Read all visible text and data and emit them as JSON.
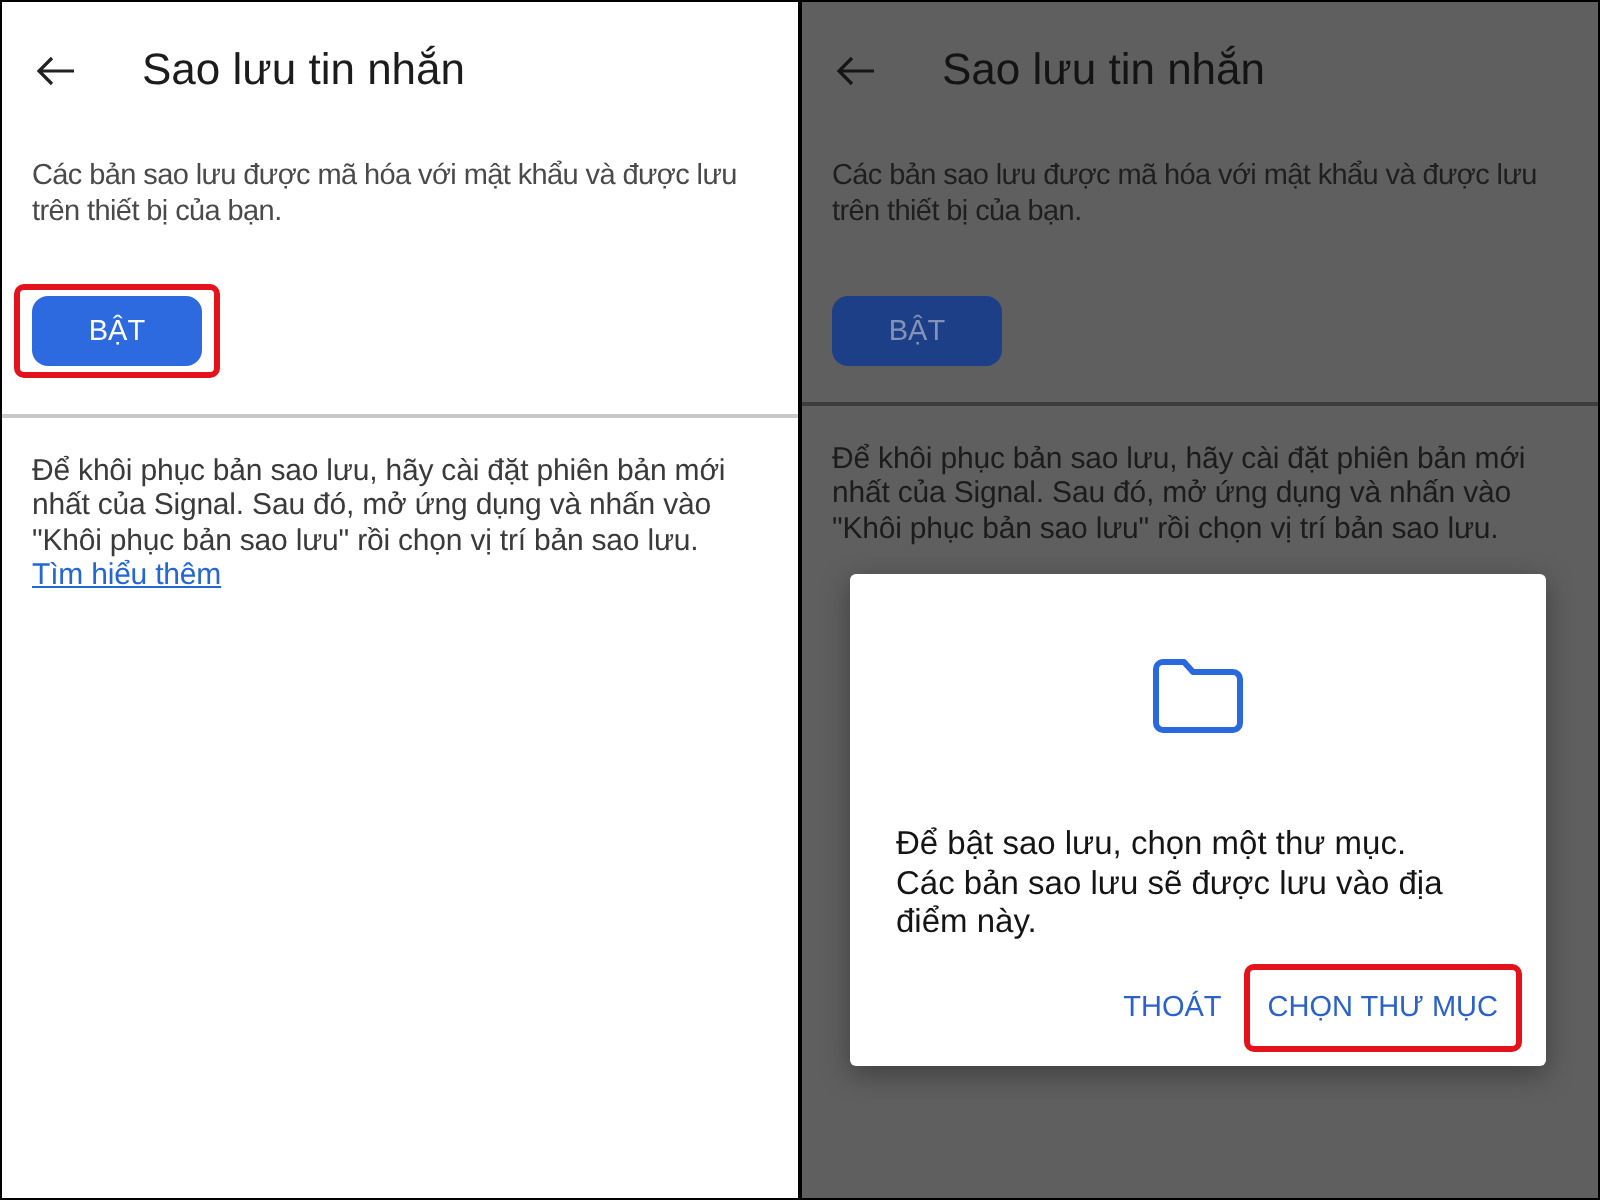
{
  "screens": [
    {
      "dimmed": false,
      "header": {
        "title": "Sao lưu tin nhắn"
      },
      "description": "Các bản sao lưu được mã hóa với mật khẩu và được lưu trên thiết bị của bạn.",
      "enable_button": {
        "label": "BẬT",
        "highlighted": true
      },
      "restore_text": "Để khôi phục bản sao lưu, hãy cài đặt phiên bản mới nhất của Signal. Sau đó, mở ứng dụng và nhấn vào \"Khôi phục bản sao lưu\" rồi chọn vị trí bản sao lưu.",
      "learn_more_link": "Tìm hiểu thêm"
    },
    {
      "dimmed": true,
      "header": {
        "title": "Sao lưu tin nhắn"
      },
      "description": "Các bản sao lưu được mã hóa với mật khẩu và được lưu trên thiết bị của bạn.",
      "enable_button": {
        "label": "BẬT",
        "highlighted": false
      },
      "restore_text": "Để khôi phục bản sao lưu, hãy cài đặt phiên bản mới nhất của Signal. Sau đó, mở ứng dụng và nhấn vào \"Khôi phục bản sao lưu\" rồi chọn vị trí bản sao lưu.",
      "dialog": {
        "message": "Để bật sao lưu, chọn một thư mục.\nCác bản sao lưu sẽ được lưu vào địa điểm này.",
        "buttons": [
          {
            "label": "THOÁT",
            "highlighted": false
          },
          {
            "label": "CHỌN THƯ MỤC",
            "highlighted": true
          }
        ]
      }
    }
  ]
}
